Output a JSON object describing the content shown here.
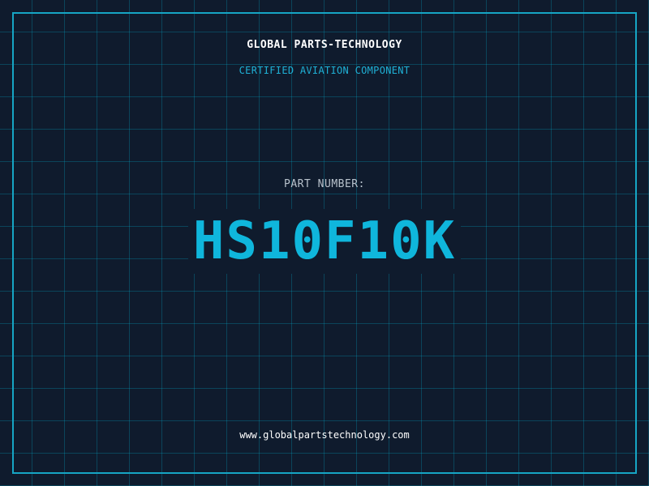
{
  "header": {
    "company": "GLOBAL PARTS-TECHNOLOGY",
    "subtitle": "CERTIFIED AVIATION COMPONENT"
  },
  "part": {
    "label": "PART NUMBER:",
    "value": "HS10F10K"
  },
  "footer": {
    "url": "www.globalpartstechnology.com"
  },
  "colors": {
    "background": "#0f1b2d",
    "grid": "#00afd2",
    "frame": "#16a5c4",
    "accent": "#0fb6dc"
  }
}
